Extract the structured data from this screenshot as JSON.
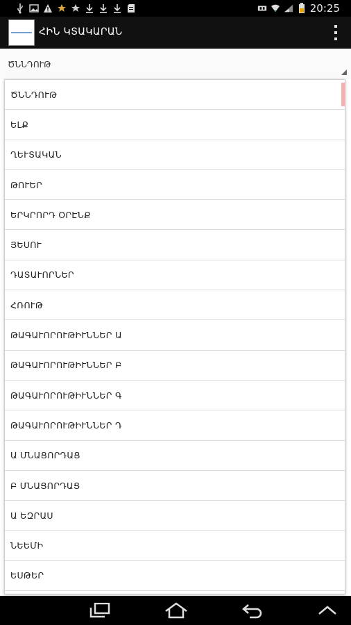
{
  "status_bar": {
    "time": "20:25",
    "left_icons": [
      "usb-icon",
      "image-icon",
      "warning-icon",
      "star-outline-icon",
      "star-icon",
      "download-icon",
      "download-icon",
      "download-icon",
      "sd-card-icon"
    ],
    "right_icons": [
      "sim-icon",
      "wifi-icon",
      "signal-icon",
      "battery-icon"
    ]
  },
  "action_bar": {
    "title": "ՀԻՆ ԿՏԱԿԱՐԱՆ",
    "overflow_icon": "overflow-menu-icon"
  },
  "spinner": {
    "selected_value": "ԾՆՆԴՈՒԹ"
  },
  "dropdown": {
    "items": [
      "ԾՆՆԴՈՒԹ",
      "ԵԼՔ",
      "ՂԵՒՏԱԿԱՆ",
      "ԹՈՒԵՐ",
      "ԵՐԿՐՈՐԴ ՕՐԷՆՔ",
      "ՅԵՍՈՒ",
      "ԴԱՏԱՒՈՐՆԵՐ",
      "ՀՌՈՒԹ",
      "ԹԱԳԱՒՈՐՈՒԹԻՒՆՆԵՐ Ա",
      "ԹԱԳԱՒՈՐՈՒԹԻՒՆՆԵՐ Բ",
      "ԹԱԳԱՒՈՐՈՒԹԻՒՆՆԵՐ Գ",
      "ԹԱԳԱՒՈՐՈՒԹԻՒՆՆԵՐ Դ",
      "Ա ՄՆԱՑՈՐԴԱՑ",
      "Բ ՄՆԱՑՈՐԴԱՑ",
      "Ա ԵԶՐԱՍ",
      "ՆԵԵՄԻ",
      "ԵՍԹԵՐ"
    ],
    "highlight_color": "#f3b2b2"
  },
  "nav_bar": {
    "buttons": [
      "recent-apps-icon",
      "home-icon",
      "back-icon",
      "collapse-icon"
    ]
  }
}
